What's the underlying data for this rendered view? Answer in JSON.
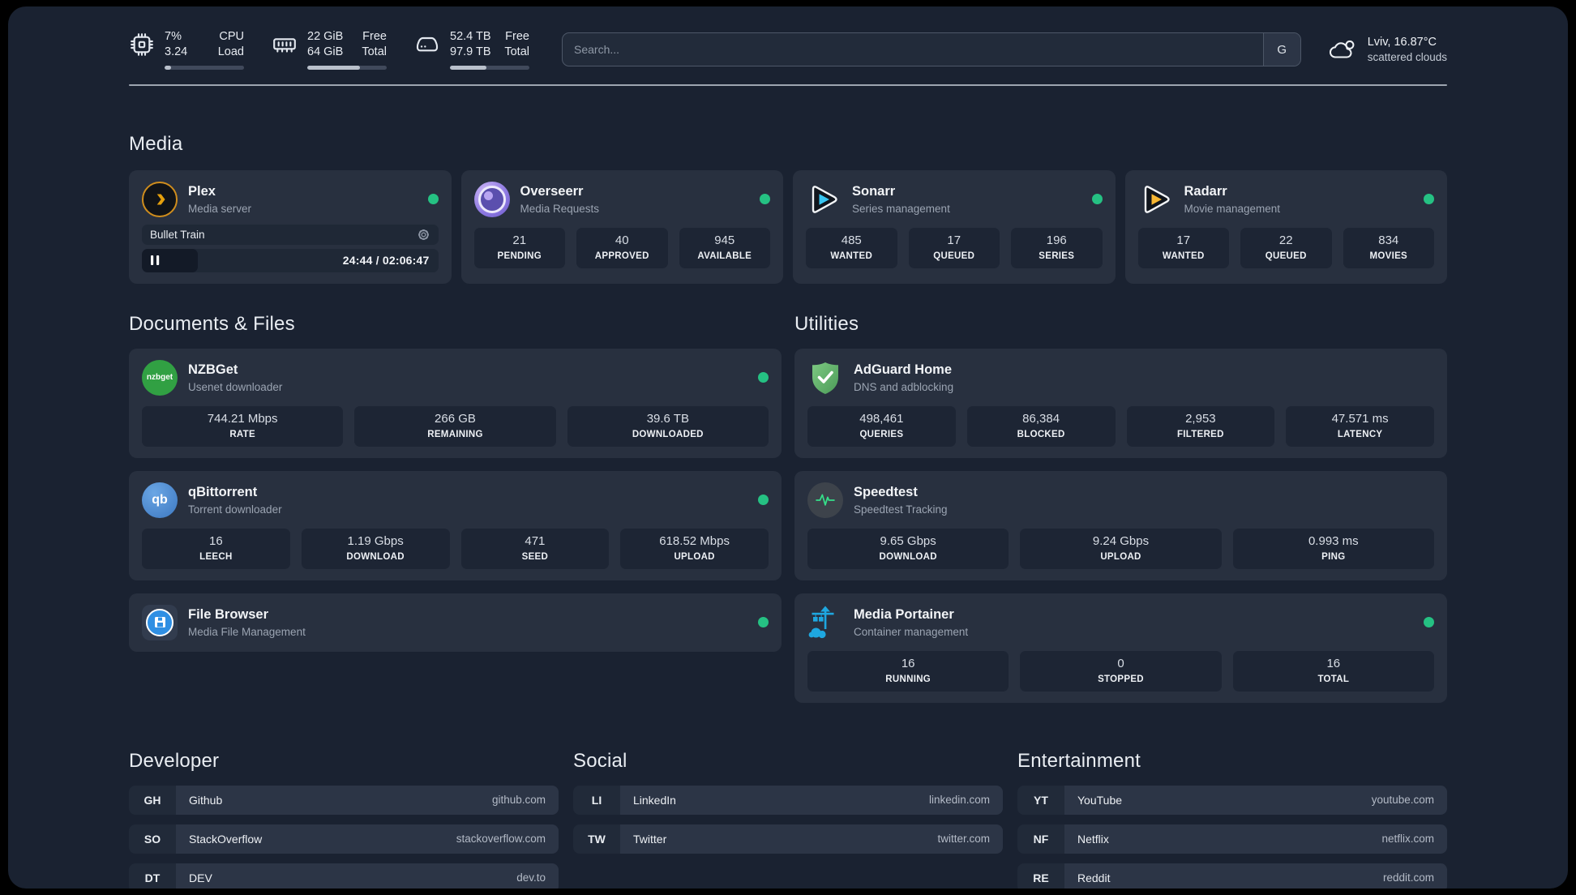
{
  "topbar": {
    "cpu": {
      "values": [
        "7%",
        "3.24"
      ],
      "labels": [
        "CPU",
        "Load"
      ],
      "progress_pct": 8
    },
    "memory": {
      "values": [
        "22 GiB",
        "64 GiB"
      ],
      "labels": [
        "Free",
        "Total"
      ],
      "progress_pct": 66
    },
    "disk": {
      "values": [
        "52.4 TB",
        "97.9 TB"
      ],
      "labels": [
        "Free",
        "Total"
      ],
      "progress_pct": 46
    },
    "search": {
      "placeholder": "Search...",
      "button_label": "G"
    },
    "weather": {
      "location_temp": "Lviv, 16.87°C",
      "condition": "scattered clouds"
    }
  },
  "sections": {
    "media": "Media",
    "documents": "Documents & Files",
    "utilities": "Utilities"
  },
  "services": {
    "plex": {
      "name": "Plex",
      "description": "Media server",
      "status": "online",
      "now_playing": {
        "title": "Bullet Train",
        "time_display": "24:44 / 02:06:47",
        "progress_pct": 19,
        "state": "paused"
      }
    },
    "overseerr": {
      "name": "Overseerr",
      "description": "Media Requests",
      "status": "online",
      "stats": [
        {
          "value": "21",
          "label": "PENDING"
        },
        {
          "value": "40",
          "label": "APPROVED"
        },
        {
          "value": "945",
          "label": "AVAILABLE"
        }
      ]
    },
    "sonarr": {
      "name": "Sonarr",
      "description": "Series management",
      "status": "online",
      "stats": [
        {
          "value": "485",
          "label": "WANTED"
        },
        {
          "value": "17",
          "label": "QUEUED"
        },
        {
          "value": "196",
          "label": "SERIES"
        }
      ]
    },
    "radarr": {
      "name": "Radarr",
      "description": "Movie management",
      "status": "online",
      "stats": [
        {
          "value": "17",
          "label": "WANTED"
        },
        {
          "value": "22",
          "label": "QUEUED"
        },
        {
          "value": "834",
          "label": "MOVIES"
        }
      ]
    },
    "nzbget": {
      "name": "NZBGet",
      "description": "Usenet downloader",
      "status": "online",
      "icon_text": "nzbget",
      "stats": [
        {
          "value": "744.21 Mbps",
          "label": "RATE"
        },
        {
          "value": "266 GB",
          "label": "REMAINING"
        },
        {
          "value": "39.6 TB",
          "label": "DOWNLOADED"
        }
      ]
    },
    "qbittorrent": {
      "name": "qBittorrent",
      "description": "Torrent downloader",
      "status": "online",
      "icon_text": "qb",
      "stats": [
        {
          "value": "16",
          "label": "LEECH"
        },
        {
          "value": "1.19 Gbps",
          "label": "DOWNLOAD"
        },
        {
          "value": "471",
          "label": "SEED"
        },
        {
          "value": "618.52 Mbps",
          "label": "UPLOAD"
        }
      ]
    },
    "filebrowser": {
      "name": "File Browser",
      "description": "Media File Management",
      "status": "online"
    },
    "adguard": {
      "name": "AdGuard Home",
      "description": "DNS and adblocking",
      "stats": [
        {
          "value": "498,461",
          "label": "QUERIES"
        },
        {
          "value": "86,384",
          "label": "BLOCKED"
        },
        {
          "value": "2,953",
          "label": "FILTERED"
        },
        {
          "value": "47.571 ms",
          "label": "LATENCY"
        }
      ]
    },
    "speedtest": {
      "name": "Speedtest",
      "description": "Speedtest Tracking",
      "stats": [
        {
          "value": "9.65 Gbps",
          "label": "DOWNLOAD"
        },
        {
          "value": "9.24 Gbps",
          "label": "UPLOAD"
        },
        {
          "value": "0.993 ms",
          "label": "PING"
        }
      ]
    },
    "portainer": {
      "name": "Media Portainer",
      "description": "Container management",
      "status": "online",
      "stats": [
        {
          "value": "16",
          "label": "RUNNING"
        },
        {
          "value": "0",
          "label": "STOPPED"
        },
        {
          "value": "16",
          "label": "TOTAL"
        }
      ]
    }
  },
  "bookmark_groups": [
    {
      "title": "Developer",
      "items": [
        {
          "abbr": "GH",
          "name": "Github",
          "url": "github.com"
        },
        {
          "abbr": "SO",
          "name": "StackOverflow",
          "url": "stackoverflow.com"
        },
        {
          "abbr": "DT",
          "name": "DEV",
          "url": "dev.to"
        }
      ]
    },
    {
      "title": "Social",
      "items": [
        {
          "abbr": "LI",
          "name": "LinkedIn",
          "url": "linkedin.com"
        },
        {
          "abbr": "TW",
          "name": "Twitter",
          "url": "twitter.com"
        }
      ]
    },
    {
      "title": "Entertainment",
      "items": [
        {
          "abbr": "YT",
          "name": "YouTube",
          "url": "youtube.com"
        },
        {
          "abbr": "NF",
          "name": "Netflix",
          "url": "netflix.com"
        },
        {
          "abbr": "RE",
          "name": "Reddit",
          "url": "reddit.com"
        }
      ]
    }
  ],
  "colors": {
    "page_bg": "#1a2231",
    "card_bg": "#28303f",
    "stat_bg": "#1d2534",
    "status_online": "#25c183",
    "plex_amber": "#e5a00d",
    "sonarr_blue": "#38c5f1",
    "radarr_amber": "#f7b733",
    "nzbget_green": "#31a043",
    "qbittorrent_blue": "#4e8fd0",
    "adguard_green": "#63b56a",
    "speedtest_green": "#35e08a",
    "portainer_blue": "#1ea7e0",
    "filebrowser_blue": "#2f8fe3"
  }
}
